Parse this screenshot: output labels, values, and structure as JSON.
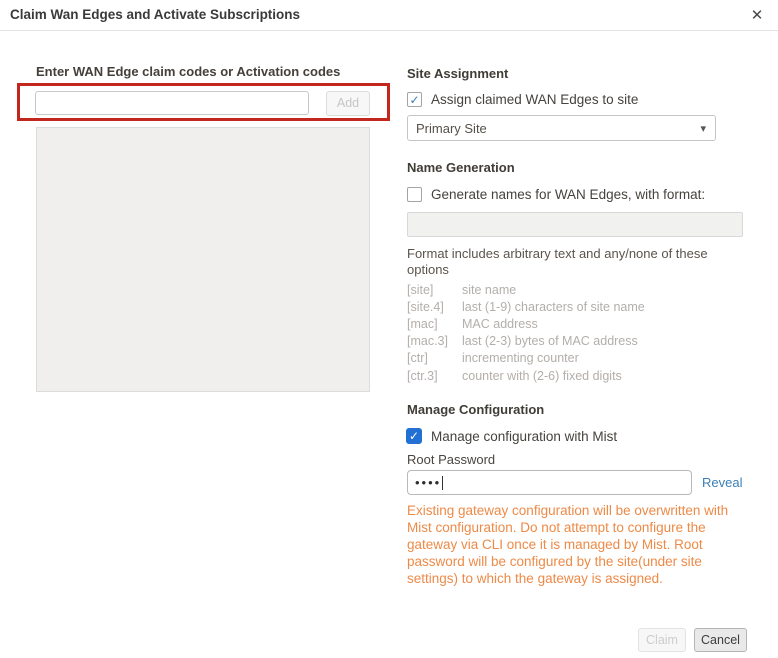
{
  "dialog": {
    "title": "Claim Wan Edges and Activate Subscriptions"
  },
  "icons": {
    "close": "✕",
    "check": "✓",
    "caret_down": "▾"
  },
  "claim_section": {
    "label": "Enter WAN Edge claim codes or Activation codes",
    "input_value": "",
    "add_button": "Add"
  },
  "site_assignment": {
    "heading": "Site Assignment",
    "checkbox_label": "Assign claimed WAN Edges to site",
    "checkbox_checked": true,
    "site_select_value": "Primary Site"
  },
  "name_generation": {
    "heading": "Name Generation",
    "checkbox_label": "Generate names for WAN Edges, with format:",
    "checkbox_checked": false,
    "format_input_value": "",
    "format_note": "Format includes arbitrary text and any/none of these options",
    "options": [
      {
        "code": "[site]",
        "desc": "site name"
      },
      {
        "code": "[site.4]",
        "desc": "last (1-9) characters of site name"
      },
      {
        "code": "[mac]",
        "desc": "MAC address"
      },
      {
        "code": "[mac.3]",
        "desc": "last (2-3) bytes of MAC address"
      },
      {
        "code": "[ctr]",
        "desc": "incrementing counter"
      },
      {
        "code": "[ctr.3]",
        "desc": "counter with (2-6) fixed digits"
      }
    ]
  },
  "manage_configuration": {
    "heading": "Manage Configuration",
    "checkbox_label": "Manage configuration with Mist",
    "checkbox_checked": true,
    "root_password_label": "Root Password",
    "password_masked": "••••",
    "reveal_link": "Reveal",
    "warning": "Existing gateway configuration will be overwritten with Mist configuration. Do not attempt to configure the gateway via CLI once it is managed by Mist. Root password will be configured by the site(under site settings) to which the gateway is assigned."
  },
  "footer": {
    "claim_button": "Claim",
    "cancel_button": "Cancel"
  },
  "colors": {
    "highlight_red": "#c3261d",
    "accent_blue": "#2270d3",
    "link_blue": "#3b7fb5",
    "warning_orange": "#ed8a47"
  }
}
